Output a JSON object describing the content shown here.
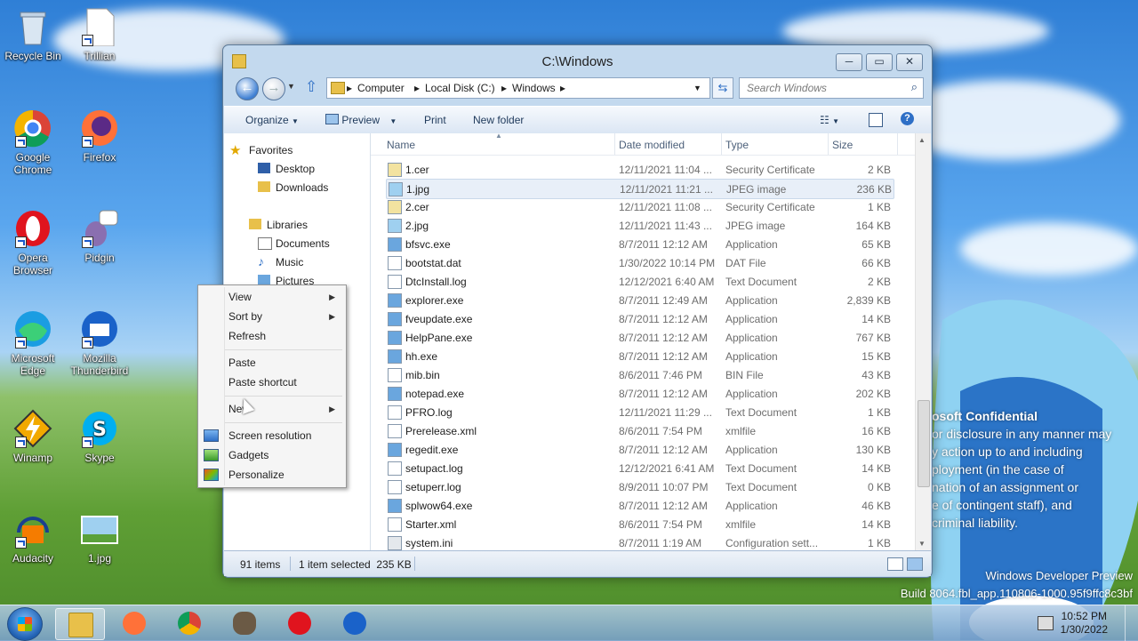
{
  "desktop": {
    "icons": [
      {
        "label": "Recycle Bin",
        "icon": "recycle-bin-icon"
      },
      {
        "label": "Trillian",
        "icon": "trillian-icon"
      },
      {
        "label": "Google Chrome",
        "icon": "chrome-icon"
      },
      {
        "label": "Firefox",
        "icon": "firefox-icon"
      },
      {
        "label": "Opera Browser",
        "icon": "opera-icon"
      },
      {
        "label": "Pidgin",
        "icon": "pidgin-icon"
      },
      {
        "label": "Microsoft Edge",
        "icon": "edge-icon"
      },
      {
        "label": "Mozilla Thunderbird",
        "icon": "thunderbird-icon"
      },
      {
        "label": "Winamp",
        "icon": "winamp-icon"
      },
      {
        "label": "Skype",
        "icon": "skype-icon"
      },
      {
        "label": "Audacity",
        "icon": "audacity-icon"
      },
      {
        "label": "1.jpg",
        "icon": "image-file-icon"
      }
    ],
    "watermark": {
      "title": "osoft Confidential",
      "lines": [
        "or disclosure in any manner may",
        "y action up to and including",
        "ployment (in the case of",
        "nation of an assignment or",
        "e of contingent staff), and",
        "criminal liability."
      ],
      "build1": "Windows Developer Preview",
      "build2": "Build 8064.fbl_app.110806-1000.95f9ffc8c3bf"
    }
  },
  "window": {
    "title": "C:\\Windows",
    "minimize": "─",
    "maximize": "▭",
    "close": "✕",
    "address": [
      "Computer",
      "Local Disk (C:)",
      "Windows"
    ],
    "search_placeholder": "Search Windows",
    "toolbar": {
      "organize": "Organize",
      "preview": "Preview",
      "print": "Print",
      "new_folder": "New folder"
    },
    "nav": {
      "favorites": "Favorites",
      "desktop": "Desktop",
      "downloads": "Downloads",
      "libraries": "Libraries",
      "documents": "Documents",
      "music": "Music",
      "pictures": "Pictures"
    },
    "columns": {
      "name": "Name",
      "date": "Date modified",
      "type": "Type",
      "size": "Size"
    },
    "files": [
      {
        "name": "1.cer",
        "date": "12/11/2021 11:04 ...",
        "type": "Security Certificate",
        "size": "2 KB"
      },
      {
        "name": "1.jpg",
        "date": "12/11/2021 11:21 ...",
        "type": "JPEG image",
        "size": "236 KB"
      },
      {
        "name": "2.cer",
        "date": "12/11/2021 11:08 ...",
        "type": "Security Certificate",
        "size": "1 KB"
      },
      {
        "name": "2.jpg",
        "date": "12/11/2021 11:43 ...",
        "type": "JPEG image",
        "size": "164 KB"
      },
      {
        "name": "bfsvc.exe",
        "date": "8/7/2011 12:12 AM",
        "type": "Application",
        "size": "65 KB"
      },
      {
        "name": "bootstat.dat",
        "date": "1/30/2022 10:14 PM",
        "type": "DAT File",
        "size": "66 KB"
      },
      {
        "name": "DtcInstall.log",
        "date": "12/12/2021 6:40 AM",
        "type": "Text Document",
        "size": "2 KB"
      },
      {
        "name": "explorer.exe",
        "date": "8/7/2011 12:49 AM",
        "type": "Application",
        "size": "2,839 KB"
      },
      {
        "name": "fveupdate.exe",
        "date": "8/7/2011 12:12 AM",
        "type": "Application",
        "size": "14 KB"
      },
      {
        "name": "HelpPane.exe",
        "date": "8/7/2011 12:12 AM",
        "type": "Application",
        "size": "767 KB"
      },
      {
        "name": "hh.exe",
        "date": "8/7/2011 12:12 AM",
        "type": "Application",
        "size": "15 KB"
      },
      {
        "name": "mib.bin",
        "date": "8/6/2011 7:46 PM",
        "type": "BIN File",
        "size": "43 KB"
      },
      {
        "name": "notepad.exe",
        "date": "8/7/2011 12:12 AM",
        "type": "Application",
        "size": "202 KB"
      },
      {
        "name": "PFRO.log",
        "date": "12/11/2021 11:29 ...",
        "type": "Text Document",
        "size": "1 KB"
      },
      {
        "name": "Prerelease.xml",
        "date": "8/6/2011 7:54 PM",
        "type": "xmlfile",
        "size": "16 KB"
      },
      {
        "name": "regedit.exe",
        "date": "8/7/2011 12:12 AM",
        "type": "Application",
        "size": "130 KB"
      },
      {
        "name": "setupact.log",
        "date": "12/12/2021 6:41 AM",
        "type": "Text Document",
        "size": "14 KB"
      },
      {
        "name": "setuperr.log",
        "date": "8/9/2011 10:07 PM",
        "type": "Text Document",
        "size": "0 KB"
      },
      {
        "name": "splwow64.exe",
        "date": "8/7/2011 12:12 AM",
        "type": "Application",
        "size": "46 KB"
      },
      {
        "name": "Starter.xml",
        "date": "8/6/2011 7:54 PM",
        "type": "xmlfile",
        "size": "14 KB"
      },
      {
        "name": "system.ini",
        "date": "8/7/2011 1:19 AM",
        "type": "Configuration sett...",
        "size": "1 KB"
      }
    ],
    "status": {
      "items": "91 items",
      "selected": "1 item selected  235 KB"
    }
  },
  "context_menu": {
    "view": "View",
    "sort_by": "Sort by",
    "refresh": "Refresh",
    "paste": "Paste",
    "paste_shortcut": "Paste shortcut",
    "new": "New",
    "screen_resolution": "Screen resolution",
    "gadgets": "Gadgets",
    "personalize": "Personalize"
  },
  "taskbar": {
    "time": "10:52 PM",
    "date": "1/30/2022"
  },
  "colors": {
    "accent": "#3e7fd3",
    "selection": "#e8eff8"
  }
}
